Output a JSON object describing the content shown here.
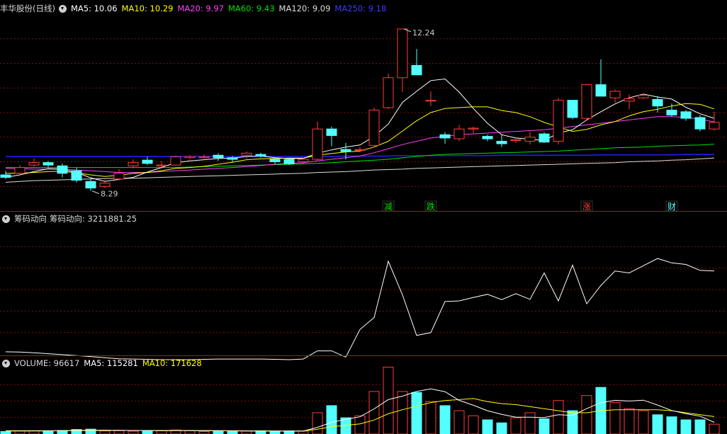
{
  "header_main": {
    "title": "丰华股份(日线)",
    "ma5": "MA5: 10.06",
    "ma10": "MA10: 10.29",
    "ma20": "MA20: 9.97",
    "ma60": "MA60: 9.43",
    "ma120": "MA120: 9.09",
    "ma250": "MA250: 9.18"
  },
  "header_chip": {
    "label": "筹码动向",
    "value": "筹码动向: 3211881.25"
  },
  "header_vol": {
    "volume": "VOLUME: 96617",
    "ma5": "MA5: 115281",
    "ma10": "MA10: 171628"
  },
  "colors": {
    "up": "#ff3c3c",
    "down": "#54ffff",
    "ma5": "#ffffff",
    "ma10": "#ffff00",
    "ma20": "#ff40ff",
    "ma60": "#00e000",
    "ma120": "#dcdcdc",
    "ma250": "#2020ff",
    "grid": "#7a1010",
    "chip_line": "#ffffff"
  },
  "chart_data": [
    {
      "type": "candlestick",
      "panel": "price",
      "ylim": [
        7.8,
        12.6
      ],
      "annotations": {
        "high": "12.24",
        "low": "8.29"
      },
      "markers": [
        {
          "label": "减",
          "color": "#00e000",
          "index": 27
        },
        {
          "label": "跌",
          "color": "#00e000",
          "index": 30
        },
        {
          "label": "涨",
          "color": "#ff3c3c",
          "index": 41
        },
        {
          "label": "财",
          "color": "#54ffff",
          "index": 47
        }
      ],
      "candles": [
        [
          8.68,
          8.62,
          8.78,
          8.58
        ],
        [
          8.72,
          8.86,
          8.92,
          8.68
        ],
        [
          8.92,
          8.98,
          9.08,
          8.88
        ],
        [
          8.98,
          8.92,
          9.02,
          8.86
        ],
        [
          8.9,
          8.72,
          8.96,
          8.62
        ],
        [
          8.78,
          8.55,
          8.86,
          8.5
        ],
        [
          8.52,
          8.36,
          8.58,
          8.29
        ],
        [
          8.4,
          8.48,
          8.56,
          8.36
        ],
        [
          8.58,
          8.72,
          8.82,
          8.54
        ],
        [
          8.9,
          8.98,
          9.06,
          8.84
        ],
        [
          9.04,
          8.96,
          9.12,
          8.92
        ],
        [
          8.9,
          8.92,
          9.02,
          8.86
        ],
        [
          8.92,
          9.12,
          9.15,
          8.9
        ],
        [
          9.1,
          9.13,
          9.16,
          9.06
        ],
        [
          9.1,
          9.12,
          9.18,
          9.08
        ],
        [
          9.16,
          9.1,
          9.21,
          9.02
        ],
        [
          9.1,
          9.06,
          9.14,
          8.98
        ],
        [
          9.16,
          9.21,
          9.25,
          9.08
        ],
        [
          9.18,
          9.14,
          9.22,
          9.1
        ],
        [
          9.06,
          9.0,
          9.1,
          8.95
        ],
        [
          9.06,
          8.95,
          9.1,
          8.92
        ],
        [
          9.0,
          9.06,
          9.1,
          8.96
        ],
        [
          9.06,
          9.8,
          9.98,
          9.02
        ],
        [
          9.8,
          9.64,
          9.86,
          9.38
        ],
        [
          9.3,
          9.25,
          9.46,
          9.06
        ],
        [
          9.3,
          9.3,
          9.36,
          9.24
        ],
        [
          9.4,
          10.26,
          10.32,
          9.38
        ],
        [
          10.32,
          11.05,
          11.15,
          10.28
        ],
        [
          11.05,
          12.24,
          12.24,
          10.7
        ],
        [
          11.35,
          11.12,
          11.75,
          11.12
        ],
        [
          10.5,
          10.5,
          10.72,
          10.36
        ],
        [
          9.66,
          9.58,
          9.72,
          9.44
        ],
        [
          9.56,
          9.8,
          9.9,
          9.5
        ],
        [
          9.82,
          9.82,
          9.86,
          9.7
        ],
        [
          9.62,
          9.56,
          9.66,
          9.5
        ],
        [
          9.5,
          9.44,
          9.66,
          9.36
        ],
        [
          9.54,
          9.54,
          9.56,
          9.46
        ],
        [
          9.5,
          9.6,
          9.73,
          9.42
        ],
        [
          9.68,
          9.48,
          9.72,
          9.46
        ],
        [
          9.5,
          10.5,
          10.56,
          9.42
        ],
        [
          10.5,
          10.08,
          10.5,
          10.04
        ],
        [
          10.06,
          10.88,
          10.9,
          10.0
        ],
        [
          10.88,
          10.6,
          11.5,
          10.6
        ],
        [
          10.56,
          10.72,
          10.76,
          10.44
        ],
        [
          10.48,
          10.54,
          10.64,
          10.28
        ],
        [
          10.56,
          10.62,
          10.66,
          10.52
        ],
        [
          10.52,
          10.36,
          10.6,
          10.2
        ],
        [
          10.26,
          10.14,
          10.42,
          10.1
        ],
        [
          10.22,
          10.06,
          10.26,
          10.0
        ],
        [
          10.08,
          9.8,
          10.14,
          9.74
        ],
        [
          9.8,
          9.96,
          10.22,
          9.76
        ]
      ],
      "ma5": [
        8.62,
        8.68,
        8.76,
        8.83,
        8.82,
        8.74,
        8.61,
        8.52,
        8.57,
        8.62,
        8.75,
        8.86,
        8.98,
        9.02,
        9.05,
        9.08,
        9.09,
        9.13,
        9.14,
        9.1,
        9.08,
        9.08,
        9.21,
        9.29,
        9.36,
        9.41,
        9.62,
        9.92,
        10.45,
        10.72,
        10.98,
        11.02,
        10.7,
        10.3,
        9.94,
        9.66,
        9.58,
        9.55,
        9.52,
        9.7,
        9.78,
        10.02,
        10.22,
        10.41,
        10.56,
        10.65,
        10.58,
        10.53,
        10.33,
        10.17,
        10.06
      ],
      "ma10": [
        8.72,
        8.72,
        8.74,
        8.76,
        8.77,
        8.73,
        8.68,
        8.64,
        8.67,
        8.72,
        8.74,
        8.78,
        8.84,
        8.86,
        8.89,
        8.94,
        8.99,
        9.05,
        9.07,
        9.08,
        9.09,
        9.09,
        9.16,
        9.2,
        9.24,
        9.26,
        9.36,
        9.5,
        9.75,
        10.0,
        10.2,
        10.3,
        10.32,
        10.34,
        10.34,
        10.25,
        10.2,
        10.1,
        9.96,
        9.85,
        9.74,
        9.79,
        9.9,
        9.98,
        10.12,
        10.22,
        10.28,
        10.36,
        10.42,
        10.4,
        10.29
      ],
      "ma20": [
        8.84,
        8.83,
        8.82,
        8.82,
        8.82,
        8.8,
        8.78,
        8.76,
        8.74,
        8.74,
        8.74,
        8.76,
        8.78,
        8.8,
        8.82,
        8.84,
        8.86,
        8.88,
        8.91,
        8.94,
        8.96,
        8.98,
        9.02,
        9.06,
        9.1,
        9.14,
        9.22,
        9.32,
        9.42,
        9.5,
        9.58,
        9.62,
        9.66,
        9.68,
        9.7,
        9.72,
        9.74,
        9.76,
        9.78,
        9.82,
        9.86,
        9.9,
        9.94,
        9.98,
        10.02,
        10.06,
        10.1,
        10.1,
        10.08,
        10.04,
        9.97
      ],
      "ma60": [
        8.86,
        8.86,
        8.86,
        8.86,
        8.86,
        8.86,
        8.86,
        8.86,
        8.86,
        8.86,
        8.86,
        8.86,
        8.86,
        8.87,
        8.88,
        8.89,
        8.9,
        8.91,
        8.92,
        8.93,
        8.94,
        8.95,
        8.96,
        8.98,
        9.0,
        9.02,
        9.04,
        9.06,
        9.1,
        9.13,
        9.16,
        9.18,
        9.19,
        9.2,
        9.21,
        9.22,
        9.23,
        9.24,
        9.25,
        9.26,
        9.28,
        9.3,
        9.32,
        9.34,
        9.35,
        9.36,
        9.38,
        9.39,
        9.4,
        9.41,
        9.43
      ],
      "ma120": [
        8.5,
        8.52,
        8.54,
        8.55,
        8.56,
        8.57,
        8.58,
        8.59,
        8.6,
        8.6,
        8.61,
        8.62,
        8.63,
        8.64,
        8.65,
        8.66,
        8.67,
        8.68,
        8.69,
        8.7,
        8.71,
        8.72,
        8.74,
        8.75,
        8.76,
        8.78,
        8.8,
        8.81,
        8.82,
        8.84,
        8.85,
        8.86,
        8.87,
        8.88,
        8.89,
        8.9,
        8.91,
        8.92,
        8.93,
        8.94,
        8.95,
        8.96,
        8.97,
        8.98,
        9.0,
        9.01,
        9.02,
        9.04,
        9.05,
        9.07,
        9.09
      ],
      "ma250": [
        9.13,
        9.13,
        9.13,
        9.13,
        9.13,
        9.13,
        9.13,
        9.13,
        9.13,
        9.13,
        9.13,
        9.13,
        9.13,
        9.13,
        9.13,
        9.13,
        9.13,
        9.13,
        9.13,
        9.13,
        9.13,
        9.13,
        9.13,
        9.13,
        9.14,
        9.14,
        9.14,
        9.14,
        9.15,
        9.15,
        9.15,
        9.15,
        9.15,
        9.15,
        9.15,
        9.16,
        9.16,
        9.16,
        9.16,
        9.16,
        9.16,
        9.16,
        9.17,
        9.17,
        9.17,
        9.17,
        9.17,
        9.17,
        9.18,
        9.18,
        9.18
      ]
    },
    {
      "type": "line",
      "panel": "chip",
      "name": "筹码动向",
      "ylim": [
        -300000,
        3800000
      ],
      "values": [
        -230000,
        -240000,
        -260000,
        -290000,
        -320000,
        -350000,
        -380000,
        -420000,
        -450000,
        -460000,
        -470000,
        -480000,
        -480000,
        -480000,
        -470000,
        -460000,
        -460000,
        -460000,
        -460000,
        -470000,
        -480000,
        -460000,
        -200000,
        -200000,
        -400000,
        480000,
        860000,
        2650000,
        1580000,
        290000,
        380000,
        1370000,
        1390000,
        1500000,
        1600000,
        1430000,
        1620000,
        1440000,
        2280000,
        1390000,
        2530000,
        1300000,
        1880000,
        2340000,
        2280000,
        2510000,
        2740000,
        2600000,
        2550000,
        2360000,
        2340000
      ]
    },
    {
      "type": "bar",
      "panel": "volume",
      "ylim": [
        0,
        650000
      ],
      "values": [
        25000,
        30000,
        32000,
        30000,
        35000,
        45000,
        48000,
        30000,
        32000,
        28000,
        35000,
        32000,
        40000,
        32000,
        25000,
        30000,
        28000,
        30000,
        32000,
        28000,
        30000,
        28000,
        210000,
        280000,
        160000,
        180000,
        420000,
        660000,
        420000,
        410000,
        320000,
        280000,
        230000,
        180000,
        140000,
        110000,
        160000,
        210000,
        150000,
        330000,
        230000,
        380000,
        460000,
        310000,
        250000,
        230000,
        190000,
        170000,
        140000,
        140000,
        96617
      ],
      "ma5": [
        30000,
        30000,
        30000,
        31000,
        32000,
        35000,
        38000,
        38000,
        36000,
        35000,
        34000,
        32000,
        33000,
        33000,
        32000,
        32000,
        31000,
        30000,
        29000,
        29000,
        29000,
        29000,
        66000,
        115000,
        145000,
        170000,
        248000,
        340000,
        374000,
        420000,
        446000,
        418000,
        332000,
        284000,
        230000,
        194000,
        166000,
        166000,
        162000,
        190000,
        184000,
        250000,
        310000,
        332000,
        326000,
        334000,
        286000,
        232000,
        200000,
        176000,
        115281
      ],
      "ma10": [
        32000,
        32000,
        32000,
        32000,
        32000,
        33000,
        34000,
        35000,
        35000,
        35000,
        35000,
        35000,
        35000,
        35000,
        34000,
        33000,
        32000,
        31000,
        31000,
        30000,
        30000,
        30000,
        47000,
        72000,
        86000,
        100000,
        138000,
        200000,
        240000,
        275000,
        310000,
        330000,
        340000,
        350000,
        320000,
        300000,
        290000,
        270000,
        250000,
        230000,
        210000,
        210000,
        230000,
        240000,
        240000,
        240000,
        240000,
        230000,
        210000,
        190000,
        171628
      ]
    }
  ]
}
